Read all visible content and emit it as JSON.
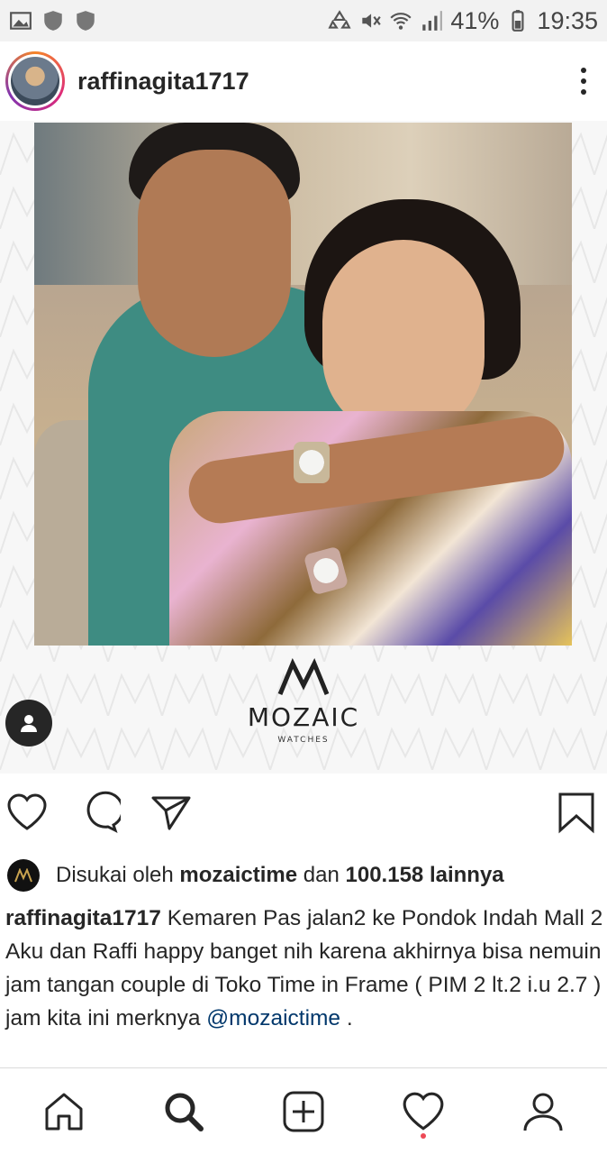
{
  "status_bar": {
    "battery": "41%",
    "time": "19:35",
    "icons": [
      "image-icon",
      "shield-icon",
      "shield-icon",
      "recycle-icon",
      "mute-icon",
      "wifi-icon",
      "signal-icon",
      "battery-icon"
    ]
  },
  "post": {
    "username": "raffinagita1717",
    "brand": {
      "name": "MOZAIC",
      "sub": "WATCHES"
    },
    "likes": {
      "prefix": "Disukai oleh",
      "liker": "mozaictime",
      "middle": "dan",
      "count": "100.158 lainnya"
    },
    "caption": {
      "username": "raffinagita1717",
      "text": "Kemaren Pas jalan2 ke Pondok Indah Mall 2 Aku dan Raffi happy banget nih karena akhirnya bisa nemuin jam tangan couple di Toko Time in Frame ( PIM 2 lt.2 i.u 2.7 ) jam kita ini merknya",
      "mention": "@mozaictime",
      "end": " ."
    }
  },
  "colors": {
    "text": "#262626",
    "mention": "#00376b",
    "notification": "#ed4956",
    "statusbar_bg": "#f2f2f2"
  },
  "bottom_nav": [
    "home-icon",
    "search-icon",
    "new-post-icon",
    "activity-icon",
    "profile-icon"
  ]
}
